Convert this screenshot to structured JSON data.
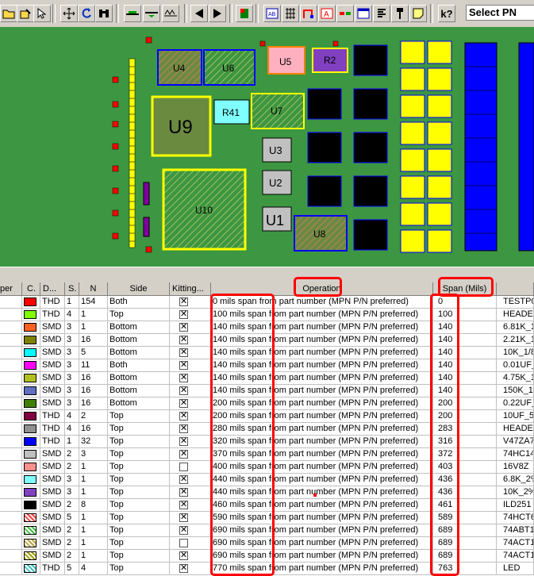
{
  "toolbar": {
    "select_pn_label": "Select PN",
    "icons": [
      "open-folder-icon",
      "edit-icon",
      "select-icon",
      "move-icon",
      "rotate-icon",
      "binoculars-icon",
      "trace-icon",
      "trace2-icon",
      "trace3-icon",
      "previous-icon",
      "next-icon",
      "flag-icon",
      "ab-icon",
      "grid-icon",
      "route-icon",
      "font-icon",
      "color-icon",
      "window-icon",
      "list-icon",
      "pin-icon",
      "note-icon",
      "help-icon"
    ]
  },
  "board": {
    "components": [
      {
        "ref": "U4"
      },
      {
        "ref": "U6"
      },
      {
        "ref": "U5"
      },
      {
        "ref": "R2"
      },
      {
        "ref": "U9"
      },
      {
        "ref": "R41"
      },
      {
        "ref": "U7"
      },
      {
        "ref": "U3"
      },
      {
        "ref": "U2"
      },
      {
        "ref": "U10"
      },
      {
        "ref": "U1"
      },
      {
        "ref": "U8"
      }
    ]
  },
  "table": {
    "headers": {
      "type": "per",
      "color": "C.",
      "d": "D...",
      "s": "S.",
      "n": "N",
      "side": "Side",
      "kitting": "Kitting...",
      "operation": "Operation",
      "span": "Span (Mils)"
    },
    "rows": [
      {
        "color": "#ff0000",
        "pattern": false,
        "d": "THD",
        "s": "1",
        "n": "154",
        "side": "Both",
        "kit": "x",
        "op": "0 mils span from part number (MPN P/N preferred)",
        "span": "0",
        "pn": "TESTP0"
      },
      {
        "color": "#80ff00",
        "pattern": false,
        "d": "THD",
        "s": "4",
        "n": "1",
        "side": "Top",
        "kit": "x",
        "op": "100 mils span from part number (MPN P/N preferred)",
        "span": "100",
        "pn": "HEADE"
      },
      {
        "color": "#ff6020",
        "pattern": false,
        "d": "SMD",
        "s": "3",
        "n": "1",
        "side": "Bottom",
        "kit": "x",
        "op": "140 mils span from part number (MPN P/N preferred)",
        "span": "140",
        "pn": "6.81K_1"
      },
      {
        "color": "#808000",
        "pattern": false,
        "d": "SMD",
        "s": "3",
        "n": "16",
        "side": "Bottom",
        "kit": "x",
        "op": "140 mils span from part number (MPN P/N preferred)",
        "span": "140",
        "pn": "2.21K_1"
      },
      {
        "color": "#00ffff",
        "pattern": false,
        "d": "SMD",
        "s": "3",
        "n": "5",
        "side": "Bottom",
        "kit": "x",
        "op": "140 mils span from part number (MPN P/N preferred)",
        "span": "140",
        "pn": "10K_1/8"
      },
      {
        "color": "#ff00ff",
        "pattern": false,
        "d": "SMD",
        "s": "3",
        "n": "11",
        "side": "Both",
        "kit": "x",
        "op": "140 mils span from part number (MPN P/N preferred)",
        "span": "140",
        "pn": "0.01UF_"
      },
      {
        "color": "#b0c020",
        "pattern": false,
        "d": "SMD",
        "s": "3",
        "n": "16",
        "side": "Bottom",
        "kit": "x",
        "op": "140 mils span from part number (MPN P/N preferred)",
        "span": "140",
        "pn": "4.75K_1"
      },
      {
        "color": "#6070c0",
        "pattern": false,
        "d": "SMD",
        "s": "3",
        "n": "16",
        "side": "Bottom",
        "kit": "x",
        "op": "140 mils span from part number (MPN P/N preferred)",
        "span": "140",
        "pn": "150K_1/"
      },
      {
        "color": "#408000",
        "pattern": false,
        "d": "SMD",
        "s": "3",
        "n": "16",
        "side": "Bottom",
        "kit": "x",
        "op": "200 mils span from part number (MPN P/N preferred)",
        "span": "200",
        "pn": "0.22UF_"
      },
      {
        "color": "#800040",
        "pattern": false,
        "d": "THD",
        "s": "4",
        "n": "2",
        "side": "Top",
        "kit": "x",
        "op": "200 mils span from part number (MPN P/N preferred)",
        "span": "200",
        "pn": "10UF_5"
      },
      {
        "color": "#909090",
        "pattern": false,
        "d": "THD",
        "s": "4",
        "n": "16",
        "side": "Top",
        "kit": "x",
        "op": "280 mils span from part number (MPN P/N preferred)",
        "span": "283",
        "pn": "HEADEI"
      },
      {
        "color": "#0000ff",
        "pattern": false,
        "d": "THD",
        "s": "1",
        "n": "32",
        "side": "Top",
        "kit": "x",
        "op": "320 mils span from part number (MPN P/N preferred)",
        "span": "316",
        "pn": "V47ZA7"
      },
      {
        "color": "#c0c0c0",
        "pattern": false,
        "d": "SMD",
        "s": "2",
        "n": "3",
        "side": "Top",
        "kit": "x",
        "op": "370 mils span from part number (MPN P/N preferred)",
        "span": "372",
        "pn": "74HC14"
      },
      {
        "color": "#ff9090",
        "pattern": false,
        "d": "SMD",
        "s": "2",
        "n": "1",
        "side": "Top",
        "kit": "",
        "op": "400 mils span from part number (MPN P/N preferred)",
        "span": "403",
        "pn": "16V8Z"
      },
      {
        "color": "#80ffff",
        "pattern": false,
        "d": "SMD",
        "s": "3",
        "n": "1",
        "side": "Top",
        "kit": "x",
        "op": "440 mils span from part number (MPN P/N preferred)",
        "span": "436",
        "pn": "6.8K_2%"
      },
      {
        "color": "#8040c0",
        "pattern": false,
        "d": "SMD",
        "s": "3",
        "n": "1",
        "side": "Top",
        "kit": "x",
        "op": "440 mils span from part number (MPN P/N preferred)",
        "span": "436",
        "pn": "10K_2%"
      },
      {
        "color": "#000000",
        "pattern": false,
        "d": "SMD",
        "s": "2",
        "n": "8",
        "side": "Top",
        "kit": "x",
        "op": "460 mils span from part number (MPN P/N preferred)",
        "span": "461",
        "pn": "ILD251"
      },
      {
        "color": "#ff4040",
        "pattern": true,
        "d": "SMD",
        "s": "5",
        "n": "1",
        "side": "Top",
        "kit": "x",
        "op": "590 mils span from part number (MPN P/N preferred)",
        "span": "589",
        "pn": "74HCT6"
      },
      {
        "color": "#40c040",
        "pattern": true,
        "d": "SMD",
        "s": "2",
        "n": "1",
        "side": "Top",
        "kit": "x",
        "op": "690 mils span from part number (MPN P/N preferred)",
        "span": "689",
        "pn": "74ABT1"
      },
      {
        "color": "#c0a040",
        "pattern": true,
        "d": "SMD",
        "s": "2",
        "n": "1",
        "side": "Top",
        "kit": "",
        "op": "690 mils span from part number (MPN P/N preferred)",
        "span": "689",
        "pn": "74ACT1"
      },
      {
        "color": "#a0a000",
        "pattern": true,
        "d": "SMD",
        "s": "2",
        "n": "1",
        "side": "Top",
        "kit": "x",
        "op": "690 mils span from part number (MPN P/N preferred)",
        "span": "689",
        "pn": "74ACT1"
      },
      {
        "color": "#40c0c0",
        "pattern": true,
        "d": "THD",
        "s": "5",
        "n": "4",
        "side": "Top",
        "kit": "x",
        "op": "770 mils span from part number (MPN P/N preferred)",
        "span": "763",
        "pn": "LED"
      }
    ]
  }
}
